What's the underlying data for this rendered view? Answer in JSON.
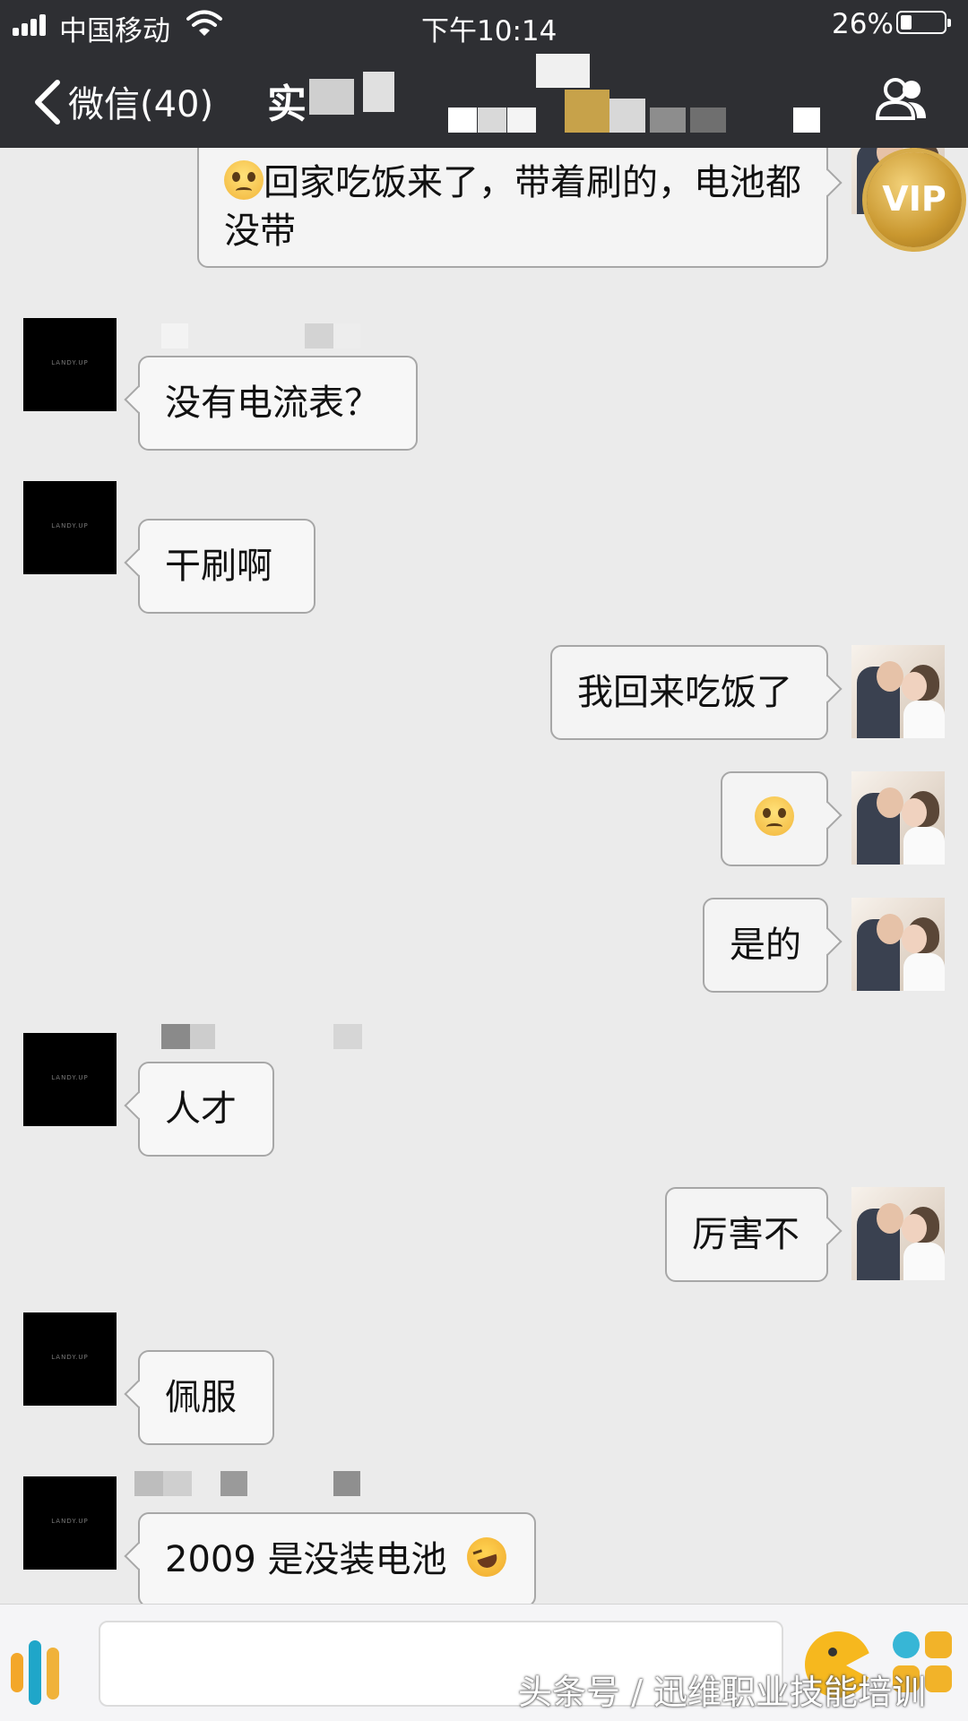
{
  "status_bar": {
    "carrier": "中国移动",
    "time": "下午10:14",
    "battery_percent_text": "26%",
    "battery_level": 0.26
  },
  "nav": {
    "back_label": "微信(40)",
    "title_visible": "实",
    "back_icon": "chevron-left-icon",
    "group_icon": "group-members-icon"
  },
  "messages": [
    {
      "side": "right",
      "text": "回家吃饭来了，带着刷的，电池都没带",
      "emoji_before": "worried-face"
    },
    {
      "side": "left",
      "text": "没有电流表？"
    },
    {
      "side": "left",
      "text": "干刷啊"
    },
    {
      "side": "right",
      "text": "我回来吃饭了"
    },
    {
      "side": "right",
      "text": "",
      "emoji_only": "worried-face"
    },
    {
      "side": "right",
      "text": "是的"
    },
    {
      "side": "left",
      "text": "人才"
    },
    {
      "side": "right",
      "text": "厉害不"
    },
    {
      "side": "left",
      "text": "佩服"
    },
    {
      "side": "left",
      "text": "2009 是没装电池",
      "emoji_after": "rolling-laughing-face"
    }
  ],
  "avatar_text": "LANDY.UP",
  "vip_badge": "VIP",
  "input": {
    "placeholder": "",
    "voice_icon": "voice-icon",
    "emoji_icon": "emoji-icon",
    "more_icon": "more-icon"
  },
  "watermark": "头条号 / 迅维职业技能培训"
}
